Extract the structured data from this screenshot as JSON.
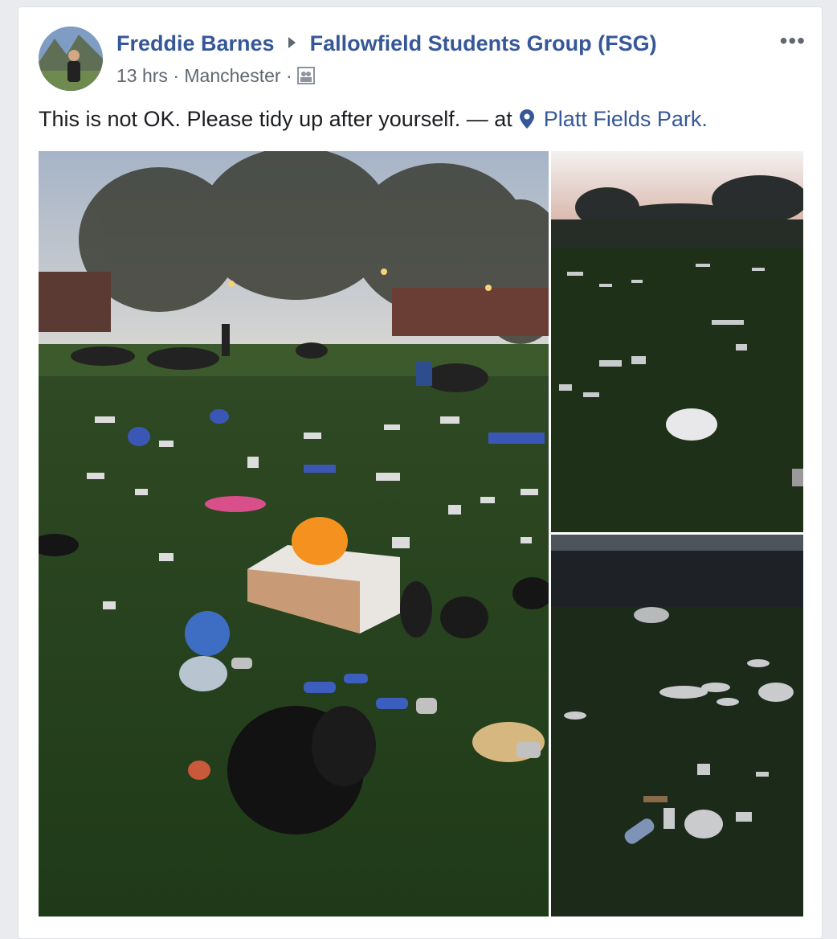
{
  "post": {
    "author": "Freddie Barnes",
    "group": "Fallowfield Students Group (FSG)",
    "time": "13 hrs",
    "location_meta": "Manchester",
    "separator": "·",
    "text": "This is not OK. Please tidy up after yourself. — at",
    "place": "Platt Fields Park.",
    "more_label": "•••"
  },
  "icons": {
    "audience": "group-icon",
    "location": "map-pin-icon",
    "more": "more-options-icon",
    "arrow": "caret-right-icon"
  },
  "colors": {
    "link": "#365899",
    "text": "#1c1e21",
    "muted": "#606770"
  }
}
